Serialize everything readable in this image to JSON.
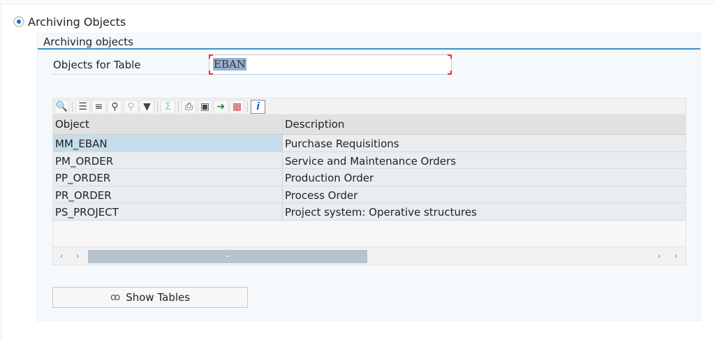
{
  "radio": {
    "label": "Archiving Objects",
    "selected": true
  },
  "group": {
    "title": "Archiving objects"
  },
  "field": {
    "label": "Objects for Table",
    "value": "EBAN"
  },
  "table": {
    "columns": [
      "Object",
      "Description"
    ],
    "rows": [
      {
        "object": "MM_EBAN",
        "description": "Purchase Requisitions"
      },
      {
        "object": "PM_ORDER",
        "description": "Service and Maintenance Orders"
      },
      {
        "object": "PP_ORDER",
        "description": "Production Order"
      },
      {
        "object": "PR_ORDER",
        "description": "Process Order"
      },
      {
        "object": "PS_PROJECT",
        "description": "Project system: Operative structures"
      }
    ]
  },
  "button": {
    "label": "Show Tables"
  }
}
